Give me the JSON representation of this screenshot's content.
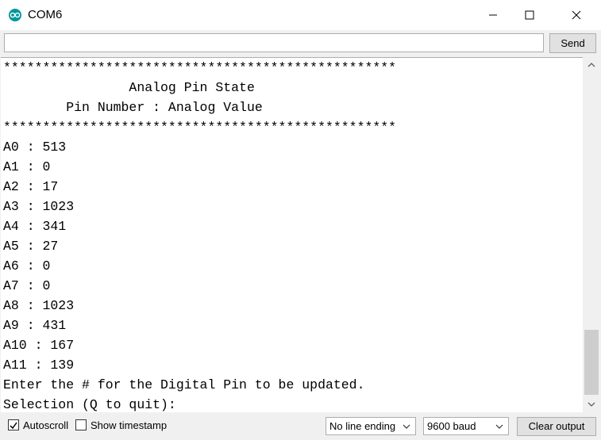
{
  "window": {
    "title": "COM6"
  },
  "send": {
    "input_value": "",
    "button_label": "Send"
  },
  "output": {
    "lines": [
      "**************************************************",
      "                Analog Pin State",
      "        Pin Number : Analog Value",
      "**************************************************",
      "A0 : 513",
      "A1 : 0",
      "A2 : 17",
      "A3 : 1023",
      "A4 : 341",
      "A5 : 27",
      "A6 : 0",
      "A7 : 0",
      "A8 : 1023",
      "A9 : 431",
      "A10 : 167",
      "A11 : 139",
      "Enter the # for the Digital Pin to be updated.",
      "Selection (Q to quit):"
    ]
  },
  "footer": {
    "autoscroll_label": "Autoscroll",
    "autoscroll_checked": true,
    "timestamp_label": "Show timestamp",
    "timestamp_checked": false,
    "line_ending": "No line ending",
    "baud": "9600 baud",
    "clear_label": "Clear output"
  },
  "colors": {
    "accent": "#00979c",
    "button_bg": "#e1e1e1",
    "border": "#adadad"
  }
}
